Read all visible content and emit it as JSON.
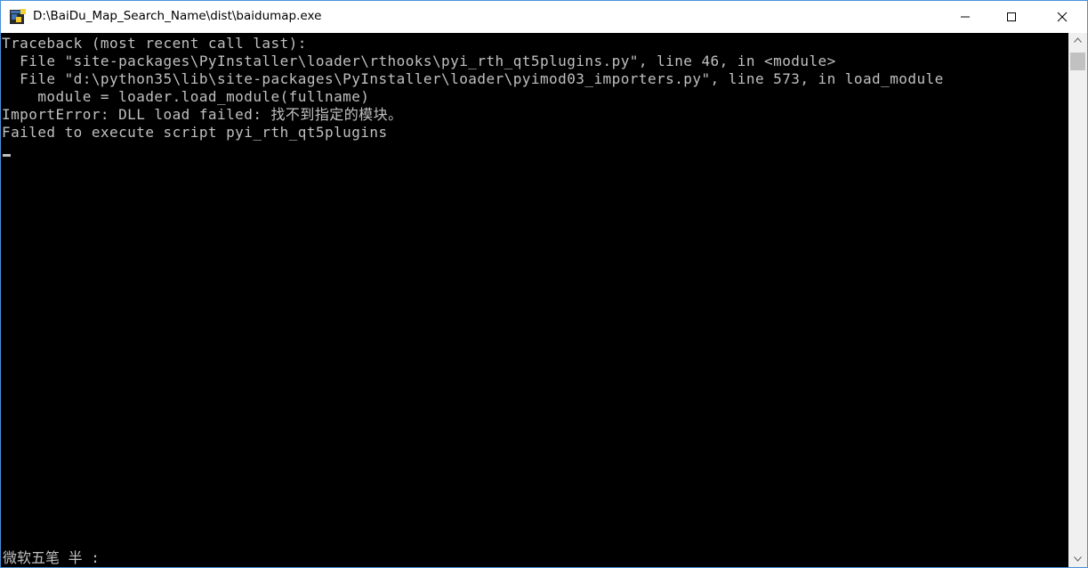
{
  "window": {
    "title": "D:\\BaiDu_Map_Search_Name\\dist\\baidumap.exe",
    "icon": "python-exe-icon",
    "controls": {
      "minimize": "minimize-icon",
      "maximize": "maximize-icon",
      "close": "close-icon"
    }
  },
  "console": {
    "lines": [
      "Traceback (most recent call last):",
      "  File \"site-packages\\PyInstaller\\loader\\rthooks\\pyi_rth_qt5plugins.py\", line 46, in <module>",
      "  File \"d:\\python35\\lib\\site-packages\\PyInstaller\\loader\\pyimod03_importers.py\", line 573, in load_module",
      "    module = loader.load_module(fullname)",
      "ImportError: DLL load failed: 找不到指定的模块。",
      "Failed to execute script pyi_rth_qt5plugins"
    ],
    "ime_status": "微软五笔 半 :"
  },
  "colors": {
    "console_bg": "#000000",
    "console_fg": "#c0c0c0",
    "titlebar_bg": "#ffffff",
    "window_border": "#4a8fd9"
  }
}
